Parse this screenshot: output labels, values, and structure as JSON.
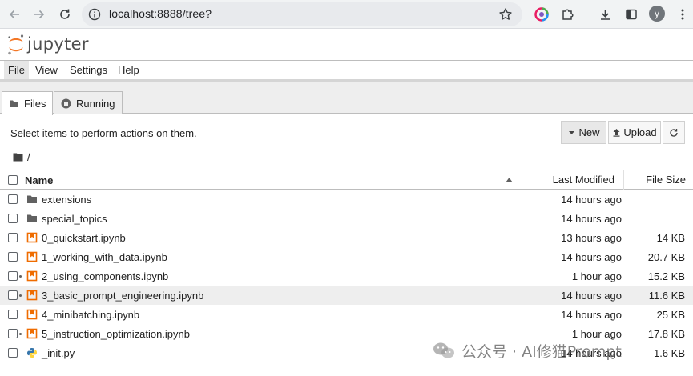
{
  "browser": {
    "url": "localhost:8888/tree?",
    "avatar_letter": "y"
  },
  "header": {
    "wordmark": "jupyter",
    "accent_color": "#f37726"
  },
  "menubar": {
    "items": [
      "File",
      "View",
      "Settings",
      "Help"
    ]
  },
  "tabs": {
    "files": "Files",
    "running": "Running"
  },
  "toolbar": {
    "hint": "Select items to perform actions on them.",
    "new_label": "New",
    "upload_label": "Upload"
  },
  "breadcrumb": {
    "path": "/"
  },
  "columns": {
    "name": "Name",
    "modified": "Last Modified",
    "size": "File Size"
  },
  "files": [
    {
      "name": "extensions",
      "type": "folder-icon",
      "modified": "14 hours ago",
      "size": "",
      "running": false,
      "highlight": false
    },
    {
      "name": "special_topics",
      "type": "folder-icon",
      "modified": "14 hours ago",
      "size": "",
      "running": false,
      "highlight": false
    },
    {
      "name": "0_quickstart.ipynb",
      "type": "notebook-icon",
      "modified": "13 hours ago",
      "size": "14 KB",
      "running": false,
      "highlight": false
    },
    {
      "name": "1_working_with_data.ipynb",
      "type": "notebook-icon",
      "modified": "14 hours ago",
      "size": "20.7 KB",
      "running": false,
      "highlight": false
    },
    {
      "name": "2_using_components.ipynb",
      "type": "notebook-icon",
      "modified": "1 hour ago",
      "size": "15.2 KB",
      "running": true,
      "highlight": false
    },
    {
      "name": "3_basic_prompt_engineering.ipynb",
      "type": "notebook-icon",
      "modified": "14 hours ago",
      "size": "11.6 KB",
      "running": true,
      "highlight": true
    },
    {
      "name": "4_minibatching.ipynb",
      "type": "notebook-icon",
      "modified": "14 hours ago",
      "size": "25 KB",
      "running": false,
      "highlight": false
    },
    {
      "name": "5_instruction_optimization.ipynb",
      "type": "notebook-icon",
      "modified": "1 hour ago",
      "size": "17.8 KB",
      "running": true,
      "highlight": false
    },
    {
      "name": "_init.py",
      "type": "python-icon",
      "modified": "14 hours ago",
      "size": "1.6 KB",
      "running": false,
      "highlight": false
    }
  ],
  "watermark": {
    "text": "公众号 · AI修猫Prompt"
  }
}
